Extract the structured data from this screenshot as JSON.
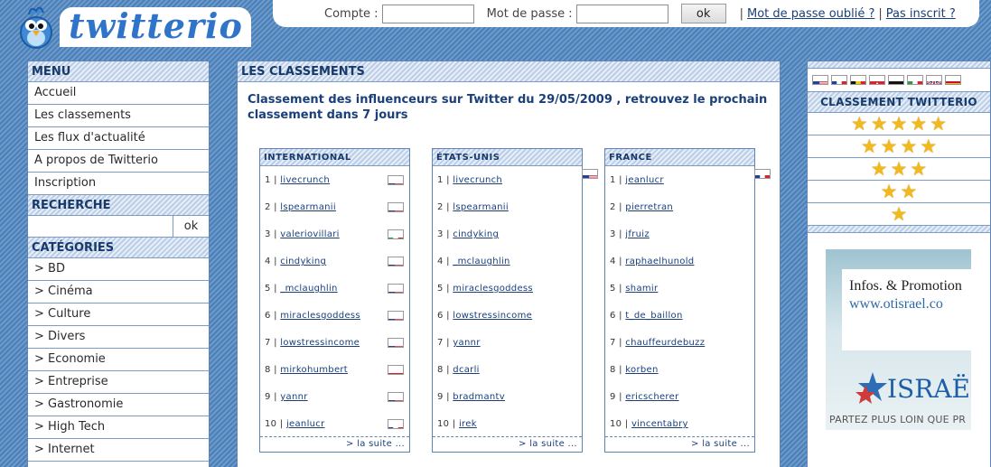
{
  "logo": {
    "text": "twitterio"
  },
  "login": {
    "account_label": "Compte :",
    "password_label": "Mot de passe :",
    "ok_label": "ok",
    "separator": "|",
    "forgot_label": "Mot de passe oublié ?",
    "register_label": "Pas inscrit ?"
  },
  "sidebar": {
    "menu_title": "MENU",
    "menu_items": [
      {
        "label": "Accueil"
      },
      {
        "label": "Les classements"
      },
      {
        "label": "Les flux d'actualité"
      },
      {
        "label": "A propos de Twitterio"
      },
      {
        "label": "Inscription"
      }
    ],
    "search_title": "RECHERCHE",
    "search_ok": "ok",
    "categories_title": "CATÉGORIES",
    "categories": [
      {
        "label": "> BD"
      },
      {
        "label": "> Cinéma"
      },
      {
        "label": "> Culture"
      },
      {
        "label": "> Divers"
      },
      {
        "label": "> Economie"
      },
      {
        "label": "> Entreprise"
      },
      {
        "label": "> Gastronomie"
      },
      {
        "label": "> High Tech"
      },
      {
        "label": "> Internet"
      }
    ]
  },
  "main": {
    "title": "LES CLASSEMENTS",
    "intro": "Classement des influenceurs sur Twitter du 29/05/2009 , retrouvez le prochain classement dans 7 jours",
    "more_label": "> la suite ...",
    "rankings": [
      {
        "title": "INTERNATIONAL",
        "flag": "",
        "rows": [
          {
            "rank": "1 |",
            "name": "livecrunch",
            "flag": "us"
          },
          {
            "rank": "2 |",
            "name": "lspearmanii",
            "flag": "us"
          },
          {
            "rank": "3 |",
            "name": "valeriovillari",
            "flag": "it"
          },
          {
            "rank": "4 |",
            "name": "cindyking",
            "flag": "us"
          },
          {
            "rank": "5 |",
            "name": "_mclaughlin",
            "flag": "us"
          },
          {
            "rank": "6 |",
            "name": "miraclesgoddess",
            "flag": "us"
          },
          {
            "rank": "7 |",
            "name": "lowstressincome",
            "flag": "us"
          },
          {
            "rank": "8 |",
            "name": "mirkohumbert",
            "flag": "ch"
          },
          {
            "rank": "9 |",
            "name": "yannr",
            "flag": "us"
          },
          {
            "rank": "10 |",
            "name": "jeanlucr",
            "flag": "fr"
          }
        ]
      },
      {
        "title": "ÉTATS-UNIS",
        "flag": "us",
        "rows": [
          {
            "rank": "1 |",
            "name": "livecrunch",
            "flag": ""
          },
          {
            "rank": "2 |",
            "name": "lspearmanii",
            "flag": ""
          },
          {
            "rank": "3 |",
            "name": "cindyking",
            "flag": ""
          },
          {
            "rank": "4 |",
            "name": "_mclaughlin",
            "flag": ""
          },
          {
            "rank": "5 |",
            "name": "miraclesgoddess",
            "flag": ""
          },
          {
            "rank": "6 |",
            "name": "lowstressincome",
            "flag": ""
          },
          {
            "rank": "7 |",
            "name": "yannr",
            "flag": ""
          },
          {
            "rank": "8 |",
            "name": "dcarli",
            "flag": ""
          },
          {
            "rank": "9 |",
            "name": "bradmantv",
            "flag": ""
          },
          {
            "rank": "10 |",
            "name": "irek",
            "flag": ""
          }
        ]
      },
      {
        "title": "FRANCE",
        "flag": "fr",
        "rows": [
          {
            "rank": "1 |",
            "name": "jeanlucr",
            "flag": ""
          },
          {
            "rank": "2 |",
            "name": "pierretran",
            "flag": ""
          },
          {
            "rank": "3 |",
            "name": "jfruiz",
            "flag": ""
          },
          {
            "rank": "4 |",
            "name": "raphaelhunold",
            "flag": ""
          },
          {
            "rank": "5 |",
            "name": "shamir",
            "flag": ""
          },
          {
            "rank": "6 |",
            "name": "t_de_baillon",
            "flag": ""
          },
          {
            "rank": "7 |",
            "name": "chauffeurdebuzz",
            "flag": ""
          },
          {
            "rank": "8 |",
            "name": "korben",
            "flag": ""
          },
          {
            "rank": "9 |",
            "name": "ericscherer",
            "flag": ""
          },
          {
            "rank": "10 |",
            "name": "vincentabry",
            "flag": ""
          }
        ]
      }
    ]
  },
  "right": {
    "language_flags": [
      "us",
      "fr",
      "be",
      "ch",
      "de",
      "it",
      "gb",
      "es"
    ],
    "ranking_title": "CLASSEMENT TWITTERIO",
    "star_levels": [
      5,
      4,
      3,
      2,
      1
    ],
    "ad": {
      "title": "Infos. & Promotion",
      "url": "www.otisrael.co",
      "brand": "ISRAË",
      "tagline": "PARTEZ PLUS LOIN QUE PR"
    }
  },
  "colors": {
    "background": "#3a6ea5",
    "accent": "#173a6b",
    "link": "#1a3f7a",
    "star": "#f2b91c"
  }
}
